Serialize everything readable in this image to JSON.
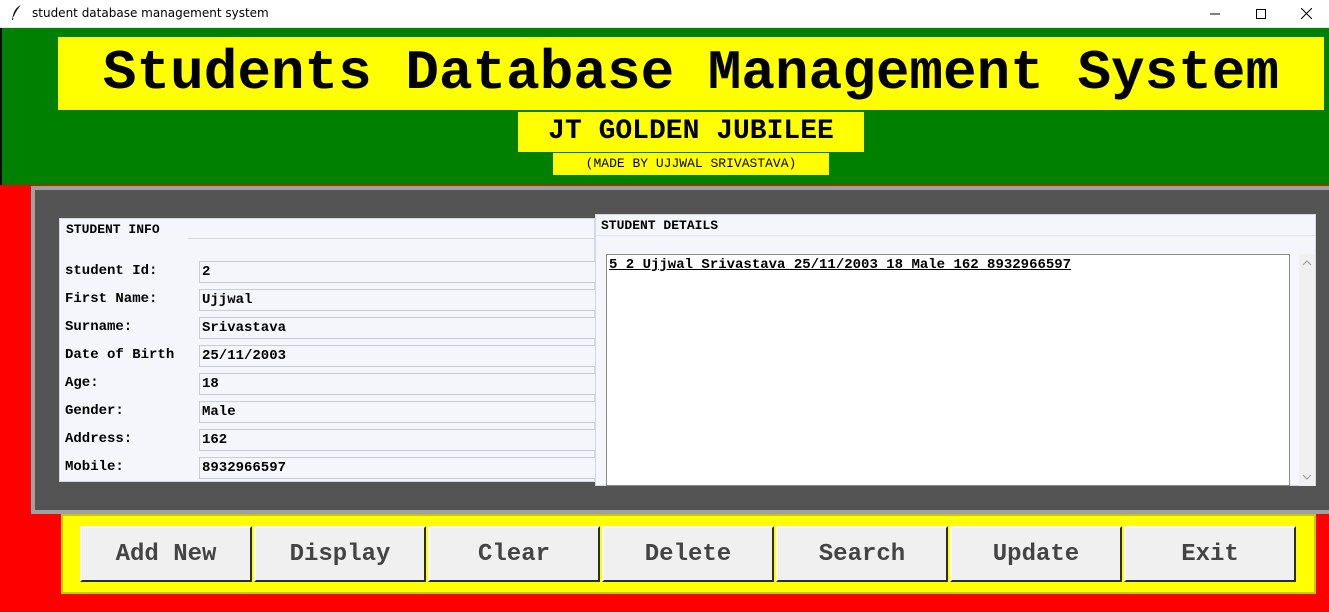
{
  "window": {
    "title": "student database management system",
    "icon": "feather-icon",
    "controls": [
      "minimize-icon",
      "maximize-icon",
      "close-icon"
    ]
  },
  "header": {
    "title": "Students Database Management System",
    "subtitle": "JT GOLDEN JUBILEE",
    "author": "(MADE BY UJJWAL SRIVASTAVA)"
  },
  "colors": {
    "background": "#ff0000",
    "header": "#008000",
    "title_bg": "#ffff00",
    "data_frame": "#545454",
    "button_frame": "#ffff00"
  },
  "student_info": {
    "label": "STUDENT INFO",
    "fields": [
      {
        "label": "student Id:",
        "value": "2"
      },
      {
        "label": "First Name:",
        "value": "Ujjwal"
      },
      {
        "label": "Surname:",
        "value": "Srivastava"
      },
      {
        "label": "Date of Birth",
        "value": "25/11/2003"
      },
      {
        "label": "Age:",
        "value": "18"
      },
      {
        "label": "Gender:",
        "value": "Male"
      },
      {
        "label": "Address:",
        "value": "162"
      },
      {
        "label": "Mobile:",
        "value": "8932966597"
      }
    ]
  },
  "student_details": {
    "label": "STUDENT DETAILS",
    "records": [
      "5 2 Ujjwal Srivastava 25/11/2003 18 Male 162 8932966597"
    ]
  },
  "buttons": [
    "Add New",
    "Display",
    "Clear",
    "Delete",
    "Search",
    "Update",
    "Exit"
  ]
}
